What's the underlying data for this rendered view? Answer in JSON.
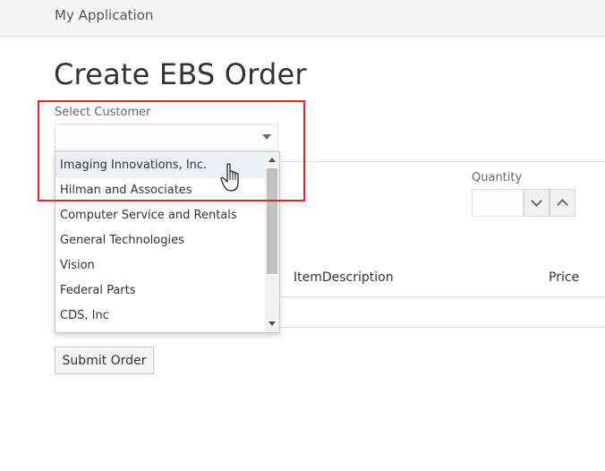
{
  "app": {
    "title": "My Application"
  },
  "page": {
    "title": "Create EBS Order"
  },
  "customer": {
    "label": "Select Customer",
    "value": "",
    "options": [
      "Imaging Innovations, Inc.",
      "Hilman and Associates",
      "Computer Service and Rentals",
      "General Technologies",
      "Vision",
      "Federal Parts",
      "CDS, Inc"
    ],
    "hovered_option": "Imaging Innovations, Inc."
  },
  "quantity": {
    "label": "Quantity",
    "value": ""
  },
  "table": {
    "columns": [
      "ItemDescription",
      "Price"
    ]
  },
  "submit": {
    "label": "Submit Order"
  },
  "colors": {
    "highlight_frame": "#e32626",
    "option_hover": "#eaf0f6",
    "topbar": "#f5f5f5"
  },
  "icons": {
    "select_arrow": "chevron-down-icon",
    "qty_down": "chevron-down-icon",
    "qty_up": "chevron-up-icon",
    "cursor": "hand-pointer-icon"
  }
}
